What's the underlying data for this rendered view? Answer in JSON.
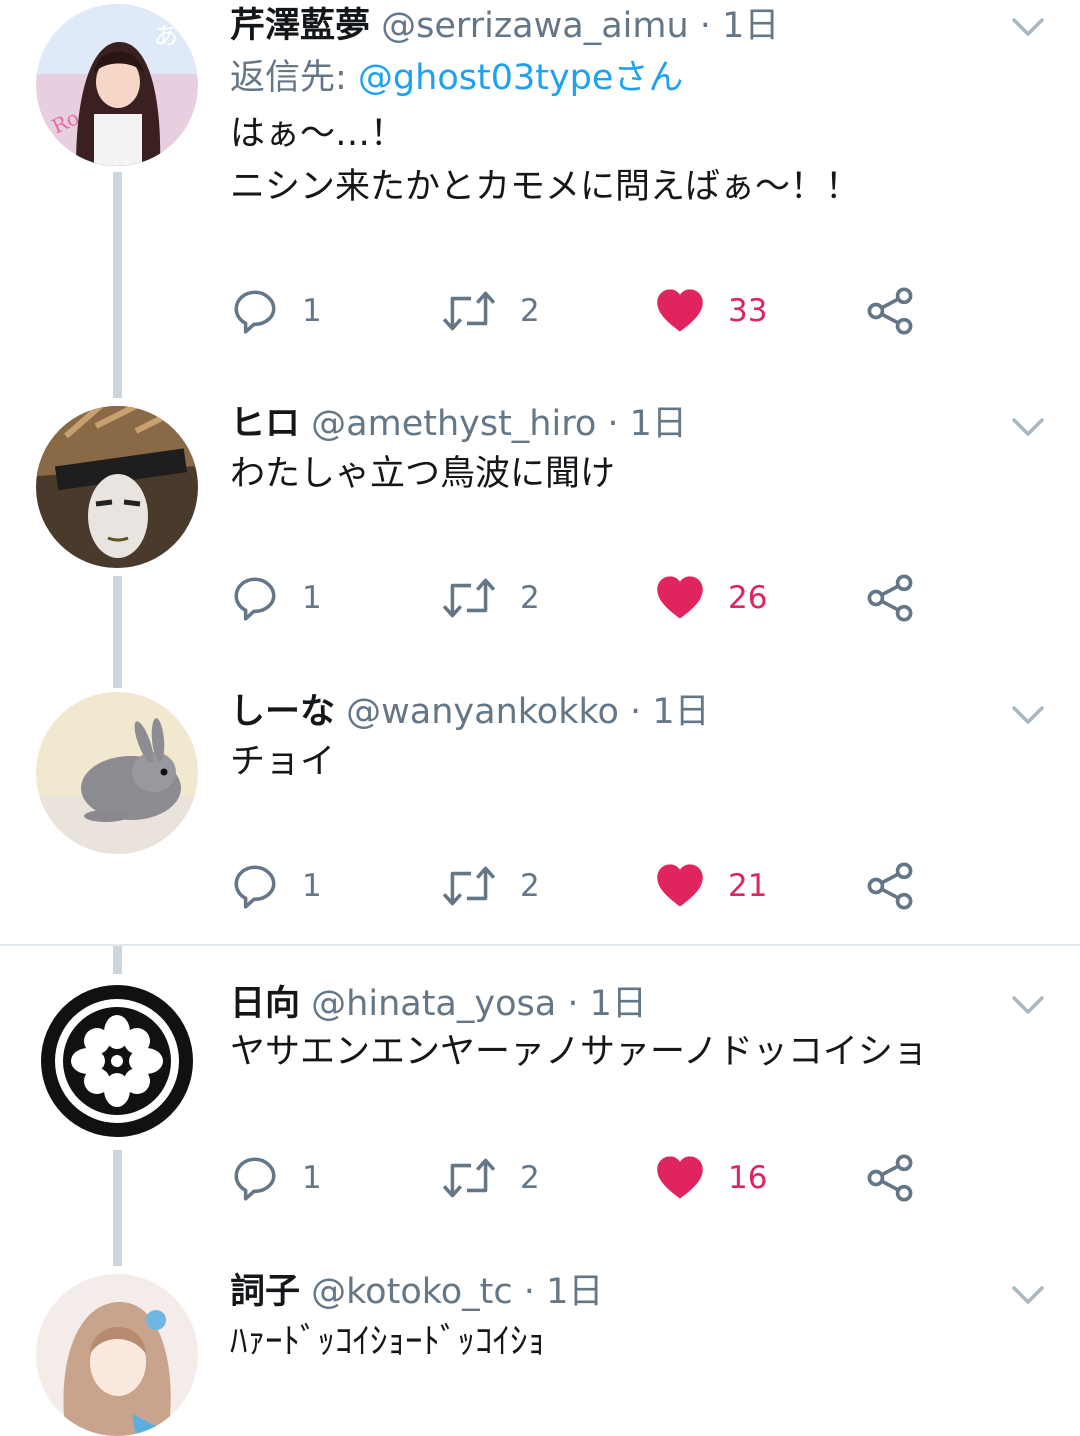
{
  "tweets": [
    {
      "name": "芹澤藍夢",
      "handle": "@serrizawa_aimu",
      "time": "1日",
      "reply_prefix": "返信先: ",
      "reply_to": "@ghost03typeさん",
      "text": "はぁ〜…！\nニシン来たかとカモメに問えばぁ〜！！",
      "replies": "1",
      "retweets": "2",
      "likes": "33"
    },
    {
      "name": "ヒロ",
      "handle": "@amethyst_hiro",
      "time": "1日",
      "text": "わたしゃ立つ鳥波に聞け",
      "replies": "1",
      "retweets": "2",
      "likes": "26"
    },
    {
      "name": "しーな",
      "handle": "@wanyankokko",
      "time": "1日",
      "text": "チョイ",
      "replies": "1",
      "retweets": "2",
      "likes": "21"
    },
    {
      "name": "日向",
      "handle": "@hinata_yosa",
      "time": "1日",
      "text": "ヤサエンエンヤーァノサァーノドッコイショ",
      "replies": "1",
      "retweets": "2",
      "likes": "16"
    },
    {
      "name": "詞子",
      "handle": "@kotoko_tc",
      "time": "1日",
      "text": "ﾊｧｰﾄﾞｯｺｲｼｮｰﾄﾞｯｺｲｼｮ"
    }
  ],
  "icons": {
    "reply": "reply-icon",
    "retweet": "retweet-icon",
    "like": "heart-icon",
    "share": "share-icon",
    "caret": "chevron-down-icon"
  },
  "colors": {
    "like": "#e0245e",
    "link": "#1da1f2",
    "muted": "#657786",
    "thread_line": "#ccd6dd"
  }
}
